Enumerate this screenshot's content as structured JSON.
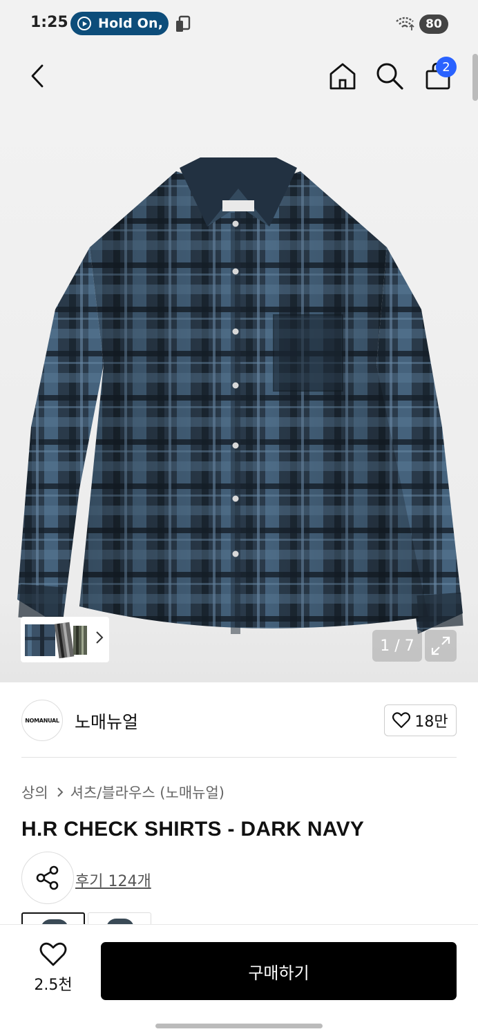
{
  "status_bar": {
    "time": "1:25",
    "media_label": "Hold On,",
    "battery": "80"
  },
  "header": {
    "cart_count": "2",
    "icons": [
      "back-icon",
      "home-icon",
      "search-icon",
      "shopping-bag-icon"
    ]
  },
  "gallery": {
    "page_counter": "1 / 7",
    "icons": [
      "chevron-right-icon",
      "expand-icon"
    ]
  },
  "brand": {
    "logo_text": "NOMANUAL",
    "name": "노매뉴얼",
    "likes": "18만"
  },
  "product": {
    "breadcrumb": [
      "상의",
      "셔츠/블라우스 (노매뉴얼)"
    ],
    "title": "H.R CHECK SHIRTS - DARK NAVY",
    "reviews": "후기 124개"
  },
  "bottom_bar": {
    "wish_count": "2.5천",
    "buy_label": "구매하기"
  },
  "colors": {
    "accent_badge": "#2962ff",
    "media_pill": "#0d4d7a",
    "buy_button": "#000000",
    "shirt_navy": "#243341",
    "shirt_blue": "#4e6f8c"
  }
}
